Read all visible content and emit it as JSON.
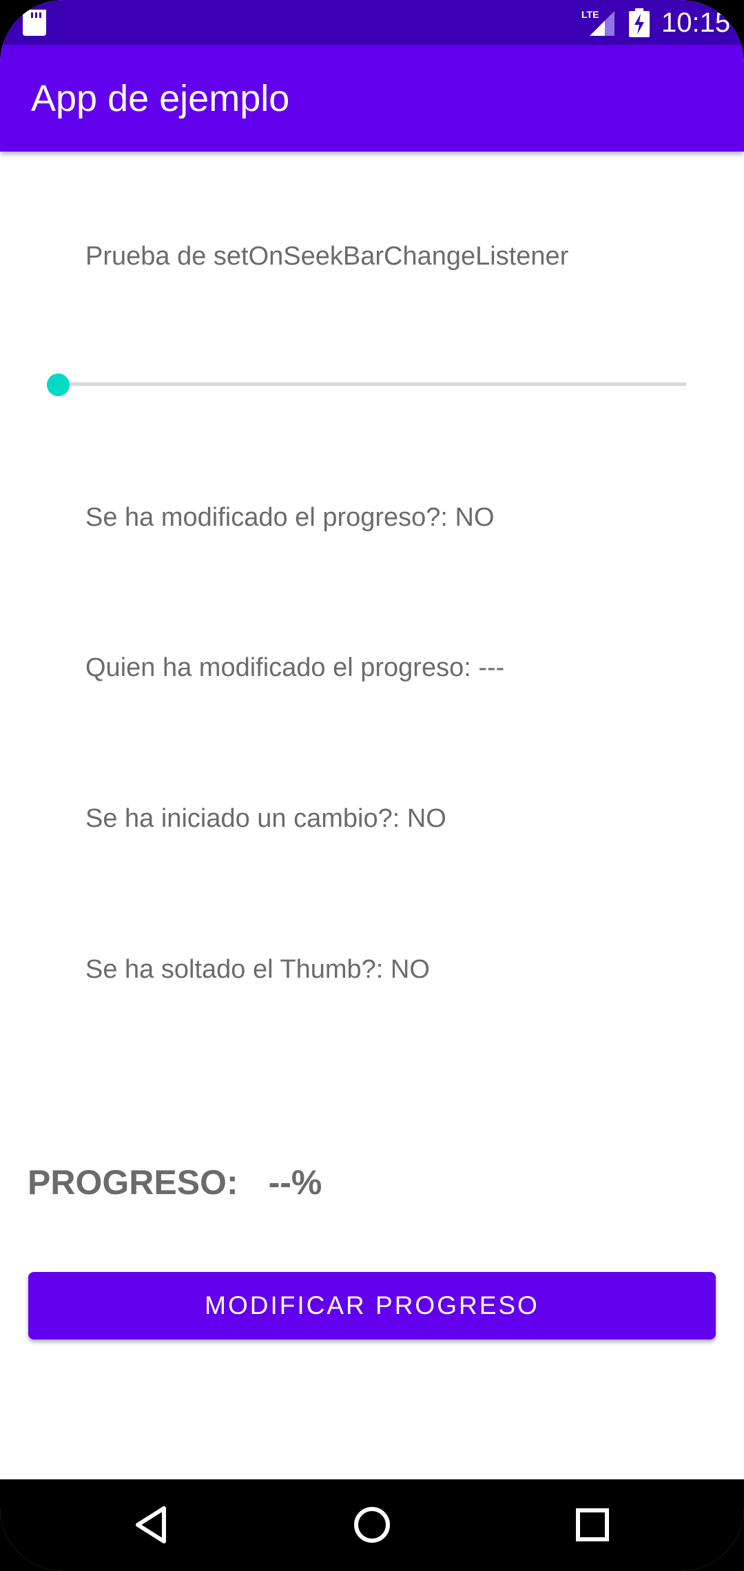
{
  "status_bar": {
    "network_label": "LTE",
    "time": "10:15"
  },
  "app_bar": {
    "title": "App de ejemplo"
  },
  "content": {
    "heading": "Prueba de setOnSeekBarChangeListener",
    "seekbar": {
      "progress": 0
    },
    "progress_changed_text": "Se ha modificado el progreso?: NO",
    "who_changed_text": "Quien ha modificado el progreso: ---",
    "change_started_text": "Se ha iniciado un cambio?: NO",
    "thumb_released_text": "Se ha soltado el Thumb?: NO",
    "progress_label": "PROGRESO:",
    "progress_value": "--%",
    "modify_button_label": "MODIFICAR PROGRESO"
  },
  "nav_bar": {
    "back_icon": "back-triangle-icon",
    "home_icon": "home-circle-icon",
    "recents_icon": "recents-square-icon"
  },
  "colors": {
    "status_bar": "#3b00b3",
    "primary": "#6200ee",
    "accent": "#03dac5",
    "text": "#6b6b6b"
  }
}
